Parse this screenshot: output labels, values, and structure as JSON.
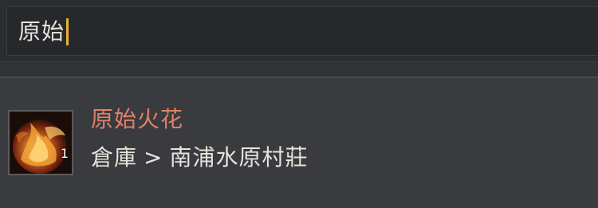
{
  "search": {
    "value": "原始"
  },
  "result": {
    "name": "原始火花",
    "quantity": "1",
    "location_parent": "倉庫",
    "location_separator": ">",
    "location_child": "南浦水原村莊",
    "icon": "fire-spark-icon"
  },
  "colors": {
    "caret": "#e6b43a",
    "item_name": "#e0806a",
    "text": "#e6e3dc"
  }
}
